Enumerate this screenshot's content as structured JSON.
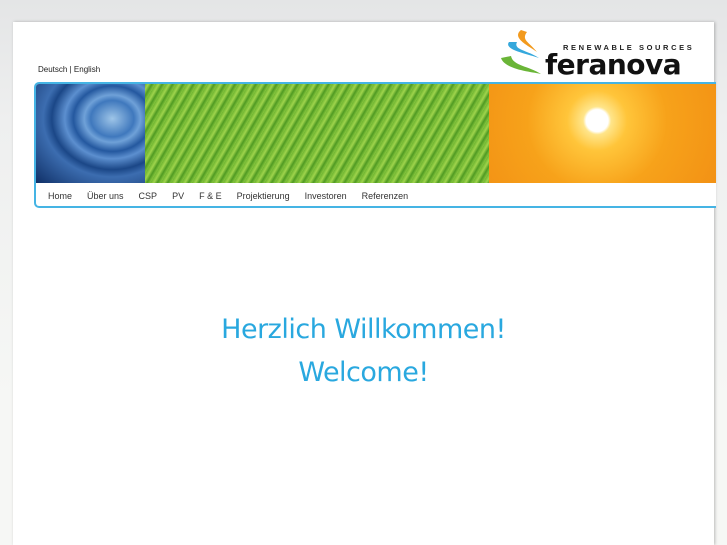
{
  "language": {
    "de": "Deutsch",
    "separator": "|",
    "en": "English"
  },
  "logo": {
    "tagline": "RENEWABLE SOURCES",
    "name": "feranova"
  },
  "nav": [
    "Home",
    "Über uns",
    "CSP",
    "PV",
    "F & E",
    "Projektierung",
    "Investoren",
    "Referenzen"
  ],
  "welcome": {
    "line1": "Herzlich Willkommen!",
    "line2": "Welcome!"
  },
  "colors": {
    "accent": "#29a8df"
  }
}
